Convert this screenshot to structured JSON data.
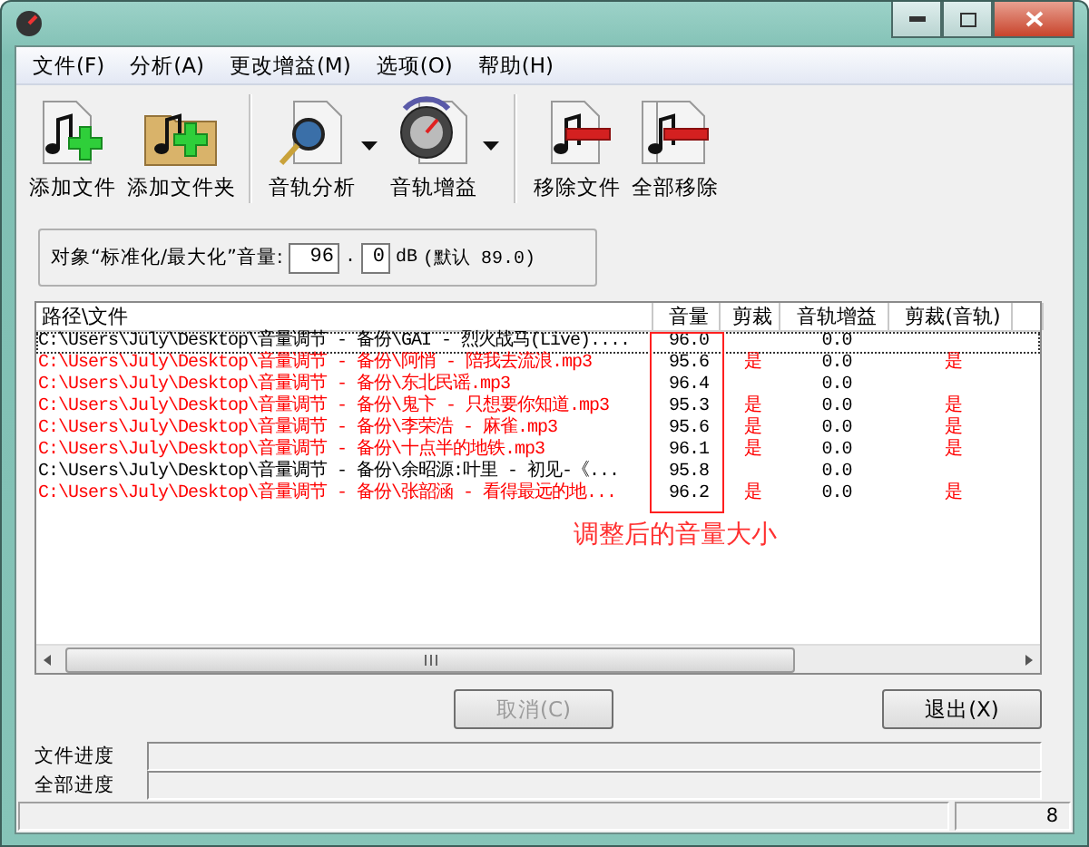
{
  "menu": [
    "文件(F)",
    "分析(A)",
    "更改增益(M)",
    "选项(O)",
    "帮助(H)"
  ],
  "toolbar": [
    [
      {
        "kind": "add-file",
        "label": "添加文件"
      },
      {
        "kind": "add-folder",
        "label": "添加文件夹"
      }
    ],
    [
      {
        "kind": "analyze",
        "label": "音轨分析"
      },
      {
        "kind": "menu-arrow"
      },
      {
        "kind": "gain",
        "label": "音轨增益"
      },
      {
        "kind": "menu-arrow"
      }
    ],
    [
      {
        "kind": "remove",
        "label": "移除文件"
      },
      {
        "kind": "remove-all",
        "label": "全部移除"
      }
    ]
  ],
  "target": {
    "label": "对象“标准化/最大化”音量:",
    "integer": "96",
    "point": ".",
    "decimal": "0",
    "unit": "dB",
    "default": "(默认 89.0)"
  },
  "table": {
    "columns": [
      "路径\\文件",
      "音量",
      "剪裁",
      "音轨增益",
      "剪裁(音轨)"
    ],
    "rows": [
      {
        "path": "C:\\Users\\July\\Desktop\\音量调节 - 备份\\GAI - 烈火战马(Live)....",
        "volume": "96.0",
        "clip": "",
        "gain": "0.0",
        "track_clip": "",
        "color": "#000000",
        "focused": true
      },
      {
        "path": "C:\\Users\\July\\Desktop\\音量调节 - 备份\\阿悄 - 陪我去流浪.mp3",
        "volume": "95.6",
        "clip": "是",
        "gain": "0.0",
        "track_clip": "是",
        "color": "#ff0000",
        "focused": false
      },
      {
        "path": "C:\\Users\\July\\Desktop\\音量调节 - 备份\\东北民谣.mp3",
        "volume": "96.4",
        "clip": "",
        "gain": "0.0",
        "track_clip": "",
        "color": "#ff0000",
        "focused": false
      },
      {
        "path": "C:\\Users\\July\\Desktop\\音量调节 - 备份\\鬼卞 - 只想要你知道.mp3",
        "volume": "95.3",
        "clip": "是",
        "gain": "0.0",
        "track_clip": "是",
        "color": "#ff0000",
        "focused": false
      },
      {
        "path": "C:\\Users\\July\\Desktop\\音量调节 - 备份\\李荣浩 - 麻雀.mp3",
        "volume": "95.6",
        "clip": "是",
        "gain": "0.0",
        "track_clip": "是",
        "color": "#ff0000",
        "focused": false
      },
      {
        "path": "C:\\Users\\July\\Desktop\\音量调节 - 备份\\十点半的地铁.mp3",
        "volume": "96.1",
        "clip": "是",
        "gain": "0.0",
        "track_clip": "是",
        "color": "#ff0000",
        "focused": false
      },
      {
        "path": "C:\\Users\\July\\Desktop\\音量调节 - 备份\\余昭源:叶里 - 初见-《...",
        "volume": "95.8",
        "clip": "",
        "gain": "0.0",
        "track_clip": "",
        "color": "#000000",
        "focused": false
      },
      {
        "path": "C:\\Users\\July\\Desktop\\音量调节 - 备份\\张韶涵 - 看得最远的地...",
        "volume": "96.2",
        "clip": "是",
        "gain": "0.0",
        "track_clip": "是",
        "color": "#ff0000",
        "focused": false
      }
    ]
  },
  "annotation": {
    "text": "调整后的音量大小"
  },
  "buttons": [
    {
      "label": "取消(C)",
      "disabled": true
    },
    {
      "label": "退出(X)",
      "disabled": false
    }
  ],
  "progress": [
    {
      "label": "文件进度",
      "level": 0
    },
    {
      "label": "全部进度",
      "level": 0
    }
  ],
  "status_bar": {
    "count": "8"
  }
}
